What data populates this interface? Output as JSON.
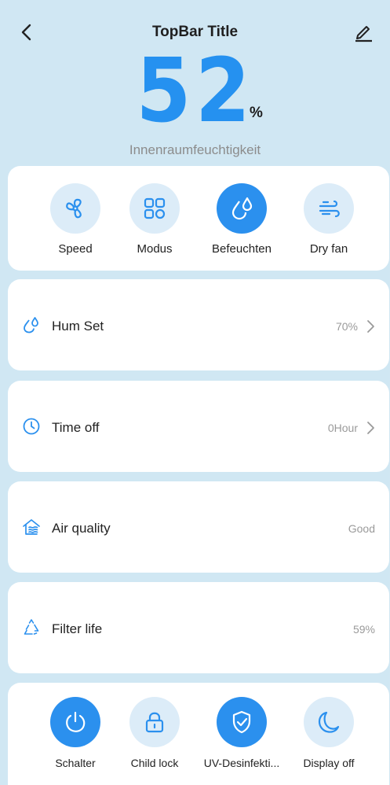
{
  "topbar": {
    "title": "TopBar Title"
  },
  "humidity": {
    "value": "52",
    "unit": "%",
    "label": "Innenraumfeuchtigkeit"
  },
  "modes": [
    {
      "label": "Speed",
      "icon": "fan-icon",
      "active": false
    },
    {
      "label": "Modus",
      "icon": "grid-mode-icon",
      "active": false
    },
    {
      "label": "Befeuchten",
      "icon": "humidify-drops-icon",
      "active": true
    },
    {
      "label": "Dry fan",
      "icon": "wind-icon",
      "active": false
    }
  ],
  "rows": [
    {
      "label": "Hum Set",
      "value": "70%",
      "icon": "humidity-drops-icon",
      "has_arrow": true
    },
    {
      "label": "Time off",
      "value": "0Hour",
      "icon": "clock-icon",
      "has_arrow": true
    },
    {
      "label": "Air quality",
      "value": "Good",
      "icon": "air-quality-house-icon",
      "has_arrow": false
    },
    {
      "label": "Filter life",
      "value": "59%",
      "icon": "filter-recycle-icon",
      "has_arrow": false
    }
  ],
  "controls": [
    {
      "label": "Schalter",
      "icon": "power-icon",
      "active": true
    },
    {
      "label": "Child lock",
      "icon": "lock-icon",
      "active": false
    },
    {
      "label": "UV-Desinfekti...",
      "icon": "shield-check-icon",
      "active": true
    },
    {
      "label": "Display off",
      "icon": "moon-icon",
      "active": false
    }
  ],
  "colors": {
    "accent": "#2b90ee",
    "background": "#d0e7f3",
    "circle_inactive": "#dcecf8",
    "muted_text": "#9a9a9a"
  }
}
